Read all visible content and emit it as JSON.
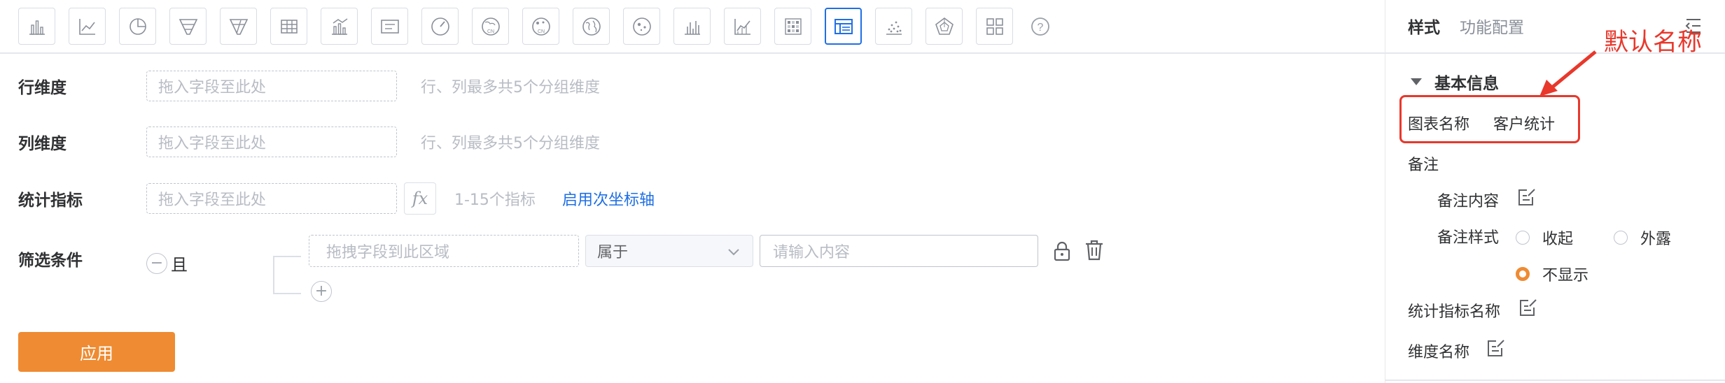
{
  "toolbar": {
    "chart_types": [
      {
        "icon": "bar-chart-icon"
      },
      {
        "icon": "line-chart-icon"
      },
      {
        "icon": "pie-chart-icon"
      },
      {
        "icon": "funnel-icon"
      },
      {
        "icon": "funnel-compare-icon"
      },
      {
        "icon": "table-icon"
      },
      {
        "icon": "bar-line-combo-icon"
      },
      {
        "icon": "text-card-icon"
      },
      {
        "icon": "gauge-icon"
      },
      {
        "icon": "china-map-icon",
        "text": "CN"
      },
      {
        "icon": "china-bubble-map-icon",
        "text": "CN"
      },
      {
        "icon": "world-map-icon"
      },
      {
        "icon": "world-bubble-map-icon"
      },
      {
        "icon": "dense-bar-icon"
      },
      {
        "icon": "area-line-icon"
      },
      {
        "icon": "heatmap-icon"
      },
      {
        "icon": "pivot-table-icon",
        "active": true
      },
      {
        "icon": "scatter-icon"
      },
      {
        "icon": "radar-icon"
      },
      {
        "icon": "dashboard-grid-icon"
      }
    ],
    "help_icon": "help-circle-icon"
  },
  "form": {
    "row_dimension": {
      "label": "行维度",
      "placeholder": "拖入字段至此处",
      "hint": "行、列最多共5个分组维度"
    },
    "col_dimension": {
      "label": "列维度",
      "placeholder": "拖入字段至此处",
      "hint": "行、列最多共5个分组维度"
    },
    "metrics": {
      "label": "统计指标",
      "placeholder": "拖入字段至此处",
      "fx": "fx",
      "hint": "1-15个指标",
      "link": "启用次坐标轴"
    },
    "filter": {
      "label": "筛选条件",
      "logic": "且",
      "minus": "−",
      "plus": "+",
      "field_placeholder": "拖拽字段到此区域",
      "operator": "属于",
      "value_placeholder": "请输入内容"
    },
    "apply_label": "应用"
  },
  "panel": {
    "tabs": [
      {
        "label": "样式",
        "active": true
      },
      {
        "label": "功能配置",
        "active": false
      }
    ],
    "annotation": "默认名称",
    "section_title": "基本信息",
    "chart_name_label": "图表名称",
    "chart_name_value": "客户统计",
    "remark_label": "备注",
    "remark_content_label": "备注内容",
    "remark_style_label": "备注样式",
    "remark_style_options": [
      {
        "label": "收起",
        "selected": false
      },
      {
        "label": "外露",
        "selected": false
      },
      {
        "label": "不显示",
        "selected": true
      }
    ],
    "metric_name_label": "统计指标名称",
    "dimension_name_label": "维度名称"
  },
  "colors": {
    "accent": "#1f6fe5",
    "primary_button": "#ef8b32",
    "annotation_red": "#e8382c"
  }
}
